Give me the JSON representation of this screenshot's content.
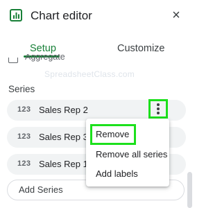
{
  "header": {
    "title": "Chart editor",
    "close_label": "×",
    "chart_icon": "chart-icon"
  },
  "tabs": [
    {
      "label": "Setup",
      "active": true
    },
    {
      "label": "Customize",
      "active": false
    }
  ],
  "aggregate": {
    "label": "Aggregate",
    "checked": false
  },
  "watermark": "SpreadsheetClass.com",
  "series": {
    "title": "Series",
    "items": [
      {
        "type_icon": "123",
        "label": "Sales Rep 2"
      },
      {
        "type_icon": "123",
        "label": "Sales Rep 3"
      },
      {
        "type_icon": "123",
        "label": "Sales Rep 1"
      }
    ],
    "add_label": "Add Series"
  },
  "menu": {
    "items": [
      {
        "label": "Remove"
      },
      {
        "label": "Remove all series"
      },
      {
        "label": "Add labels"
      }
    ]
  },
  "colors": {
    "accent": "#188038",
    "highlight": "#1ce01c",
    "chip_bg": "#f1f3f4"
  }
}
